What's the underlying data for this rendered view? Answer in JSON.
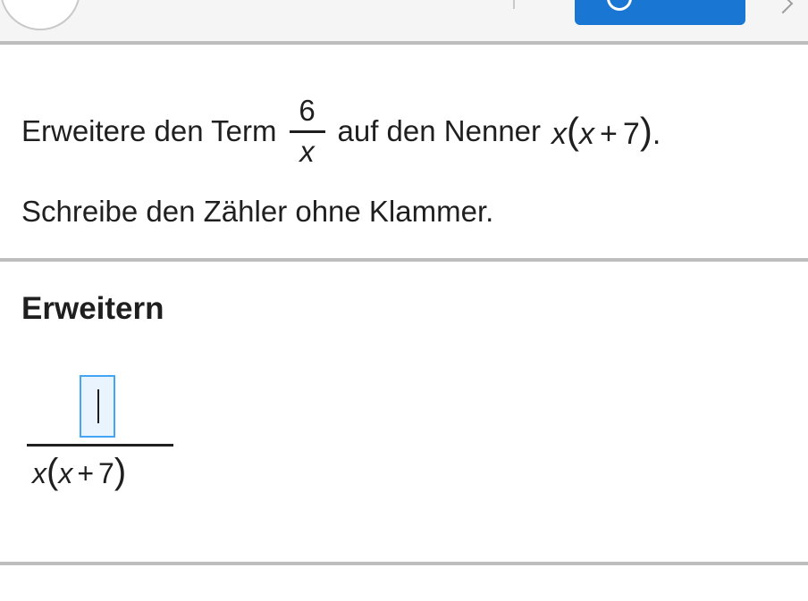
{
  "top": {
    "colors": {
      "button": "#1976d2",
      "divider": "#bdbdbd"
    }
  },
  "task": {
    "prefix": "Erweitere den Term",
    "fraction_numerator": "6",
    "fraction_denominator": "x",
    "middle": "auf den Nenner",
    "nenner_var1": "x",
    "nenner_paren_open": "(",
    "nenner_var2": "x",
    "nenner_op": "+",
    "nenner_const": "7",
    "nenner_paren_close": ")",
    "suffix": ".",
    "instruction": "Schreibe den Zähler ohne Klammer."
  },
  "section": {
    "title": "Erweitern"
  },
  "answer": {
    "numerator_value": "",
    "den_var1": "x",
    "den_paren_open": "(",
    "den_var2": "x",
    "den_op": "+",
    "den_const": "7",
    "den_paren_close": ")",
    "input_color": "#42a5f5"
  }
}
